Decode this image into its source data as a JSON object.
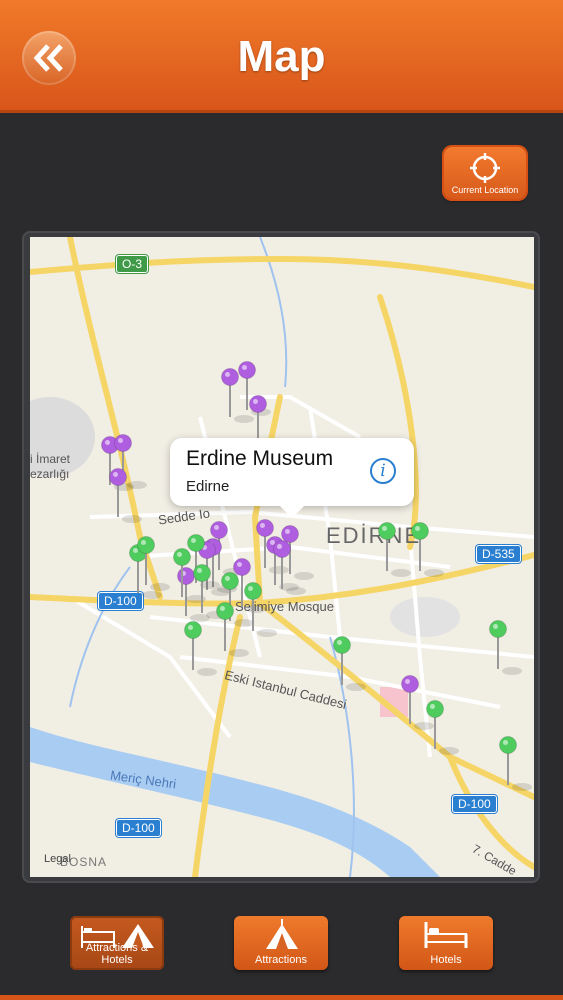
{
  "header": {
    "title": "Map",
    "back_icon": "double-chevron-left-icon"
  },
  "current_location": {
    "label": "Current Location",
    "icon": "crosshair-icon"
  },
  "map": {
    "labels": {
      "o3": "O-3",
      "d535": "D-535",
      "d100_a": "D-100",
      "d100_b": "D-100",
      "d100_c": "D-100",
      "sedde": "Sedde Io",
      "edirne": "EDİRNE",
      "mosque": "Selimiye Mosque",
      "eski": "Eski Istanbul Caddesi",
      "imaret": "i İmaret",
      "mezarligi": "ezarlığı",
      "meric": "Meriç Nehri",
      "bosna": "BOSNA",
      "cadde": "7. Cadde",
      "legal": "Legal"
    },
    "pin_colors": {
      "attraction": "#b05ee0",
      "hotel": "#4fcc5e"
    }
  },
  "callout": {
    "title": "Erdine Museum",
    "subtitle": "Edirne",
    "icon": "info-icon"
  },
  "tabs": [
    {
      "label": "Attractions & Hotels",
      "icon": "bed-and-tent-icon",
      "selected": true
    },
    {
      "label": "Attractions",
      "icon": "tent-icon",
      "selected": false
    },
    {
      "label": "Hotels",
      "icon": "bed-icon",
      "selected": false
    }
  ]
}
